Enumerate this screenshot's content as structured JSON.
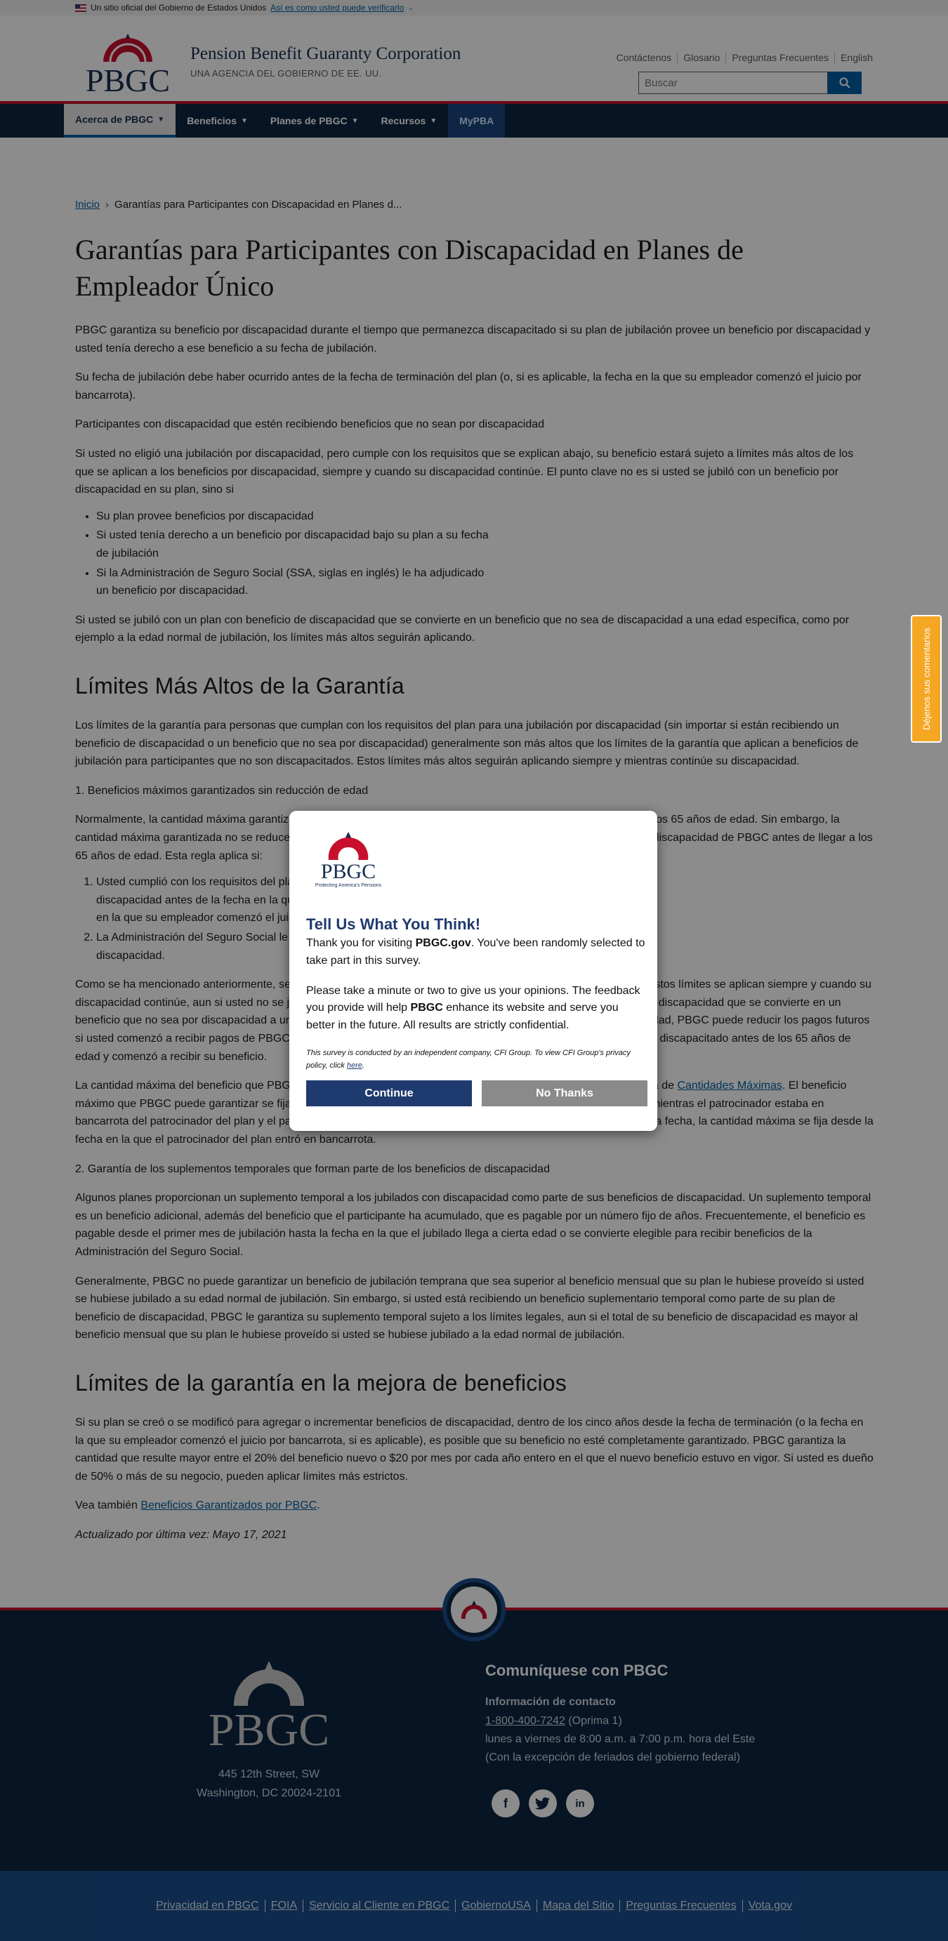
{
  "gov_banner": {
    "text": "Un sitio oficial del Gobierno de Estados Unidos",
    "link": "Así es como usted puede verificarlo"
  },
  "header": {
    "agency_name": "Pension Benefit Guaranty Corporation",
    "agency_sub": "UNA AGENCIA DEL GOBIERNO DE EE. UU.",
    "logo_text": "PBGC",
    "utility_links": [
      "Contáctenos",
      "Glosario",
      "Preguntas Frecuentes",
      "English"
    ],
    "search_placeholder": "Buscar"
  },
  "nav": {
    "items": [
      "Acerca de PBGC",
      "Beneficios",
      "Planes de PBGC",
      "Recursos",
      "MyPBA"
    ]
  },
  "breadcrumb": {
    "home": "Inicio",
    "current": "Garantías para Participantes con Discapacidad en Planes d..."
  },
  "page": {
    "title": "Garantías para Participantes con Discapacidad en Planes de Empleador Único",
    "p1": "PBGC garantiza su beneficio por discapacidad durante el tiempo que permanezca discapacitado si su plan de jubilación provee un beneficio por discapacidad y usted tenía derecho a ese beneficio a su fecha de jubilación.",
    "p2": "Su fecha de jubilación debe haber ocurrido antes de la fecha de terminación del plan (o, si es aplicable, la fecha en la que su empleador comenzó el juicio por bancarrota).",
    "p3": "Participantes con discapacidad que estén recibiendo beneficios que no sean por discapacidad",
    "p4": "Si usted no eligió una jubilación por discapacidad, pero cumple con los requisitos que se explican abajo, su beneficio estará sujeto a límites más altos de los que se aplican a los beneficios por discapacidad, siempre y cuando su discapacidad continúe. El punto clave no es si usted se jubiló con un beneficio por discapacidad en su plan, sino si",
    "list1": [
      "Su plan provee beneficios por discapacidad",
      "Si usted tenía derecho a un beneficio por discapacidad bajo su plan a su fecha de jubilación",
      "Si la Administración de Seguro Social (SSA, siglas en inglés) le ha adjudicado un beneficio por discapacidad."
    ],
    "p5": "Si usted se jubiló con un plan con beneficio de discapacidad que se convierte en un beneficio que no sea de discapacidad a una edad específica, como por ejemplo a la edad normal de jubilación, los límites más altos seguirán aplicando.",
    "h2_1": "Límites Más Altos de la Garantía",
    "p6": "Los límites de la garantía para personas que cumplan con los requisitos del plan para una jubilación por discapacidad (sin importar si están recibiendo un beneficio de discapacidad o un beneficio que no sea por discapacidad) generalmente son más altos que los límites de la garantía que aplican a beneficios de jubilación para participantes que no son discapacitados. Estos límites más altos seguirán aplicando siempre y mientras continúe su discapacidad.",
    "p7": "1. Beneficios máximos garantizados sin reducción de edad",
    "p8": "Normalmente, la cantidad máxima garantizada por PBGC se reduce si usted comienza a recibir beneficios antes de los 65 años de edad. Sin embargo, la cantidad máxima garantizada no se reduce por edad si usted recibe beneficios de PBGC y cumple los requisitos de discapacidad de PBGC antes de llegar a los 65 años de edad. Esta regla aplica si:",
    "list2": [
      "Usted cumplió con los requisitos del plan para recibir un beneficio de discapacidad antes de la fecha en la que terminó su plan (o, si aplica, la fecha en la que su empleador comenzó el juicio por bancarrota), y",
      "La Administración del Seguro Social le ha adjudicado beneficios por discapacidad."
    ],
    "p9": "Como se ha mencionado anteriormente, se aplican límites más altos que los aplicables a beneficios por jubilación. Estos límites se aplican siempre y cuando su discapacidad continúe, aun si usted no se jubiló con un beneficio por discapacidad o si se jubiló con un beneficio por discapacidad que se convierte en un beneficio que no sea por discapacidad a una edad específica. Si su discapacidad termina antes de los 65 años de edad, PBGC puede reducir los pagos futuros si usted comenzó a recibir pagos de PBGC después de los 65 años de edad. El máximo se reduce si se le considera discapacitado antes de los 65 años de edad y comenzó a recibir su beneficio.",
    "p10a": "La cantidad máxima del beneficio que PBGC puede garantizar depende de cuándo terminó su plan. Consulte la tabla de ",
    "p10link": "Cantidades Máximas",
    "p10b": ". El beneficio máximo que PBGC puede garantizar se fija desde la fecha de terminación del plan. Sin embargo, si el plan terminó mientras el patrocinador estaba en bancarrota del patrocinador del plan y el patrocinador entró en bancarrota el 16 de octubre de 2008 o después de esa fecha, la cantidad máxima se fija desde la fecha en la que el patrocinador del plan entró en bancarrota.",
    "p11": "2. Garantía de los suplementos temporales que forman parte de los beneficios de discapacidad",
    "p12": "Algunos planes proporcionan un suplemento temporal a los jubilados con discapacidad como parte de sus beneficios de discapacidad. Un suplemento temporal es un beneficio adicional, además del beneficio que el participante ha acumulado, que es pagable por un número fijo de años. Frecuentemente, el beneficio es pagable desde el primer mes de jubilación hasta la fecha en la que el jubilado llega a cierta edad o se convierte elegible para recibir beneficios de la Administración del Seguro Social.",
    "p13": "Generalmente, PBGC no puede garantizar un beneficio de jubilación temprana que sea superior al beneficio mensual que su plan le hubiese proveído si usted se hubiese jubilado a su edad normal de jubilación. Sin embargo, si usted está recibiendo un beneficio suplementario temporal como parte de su plan de beneficio de discapacidad, PBGC le garantiza su suplemento temporal sujeto a los límites legales, aun si el total de su beneficio de discapacidad es mayor al beneficio mensual que su plan le hubiese proveído si usted se hubiese jubilado a la edad normal de jubilación.",
    "h2_2": "Límites de la garantía en la mejora de beneficios",
    "p14": "Si su plan se creó o se modificó para agregar o incrementar beneficios de discapacidad, dentro de los cinco años desde la fecha de terminación (o la fecha en la que su empleador comenzó el juicio por bancarrota, si es aplicable), es posible que su beneficio no esté completamente garantizado. PBGC garantiza la cantidad que resulte mayor entre el 20% del beneficio nuevo o $20 por mes por cada año entero en el que el nuevo beneficio estuvo en vigor. Si usted es dueño de 50% o más de su negocio, pueden aplicar límites más estrictos.",
    "see_also_prefix": "Vea también ",
    "see_also_link": "Beneficios Garantizados por PBGC",
    "see_also_suffix": ".",
    "updated": "Actualizado por última vez: Mayo 17, 2021"
  },
  "feedback_tab": "Déjenos sus comentarios",
  "survey": {
    "logo_text": "PBGC",
    "logo_tagline": "Protecting America's Pensions",
    "title": "Tell Us What You Think!",
    "intro_prefix": "Thank you for visiting ",
    "intro_bold": "PBGC.gov",
    "intro_suffix": ". You've been randomly selected to take part in this survey.",
    "body_prefix": "Please take a minute or two to give us your opinions. The feedback you provide will help ",
    "body_bold": "PBGC",
    "body_suffix": " enhance its website and serve you better in the future. All results are strictly confidential.",
    "fine_print": "This survey is conducted by an independent company, CFI Group. To view CFI Group's privacy policy, click ",
    "fine_link": "here",
    "fine_end": ".",
    "continue": "Continue",
    "no_thanks": "No Thanks"
  },
  "footer": {
    "logo_text": "PBGC",
    "address_line1": "445 12th Street, SW",
    "address_line2": "Washington, DC 20024-2101",
    "contact_title": "Comuníquese con PBGC",
    "contact_label": "Información de contacto",
    "phone": "1-800-400-7242",
    "phone_suffix": " (Oprima 1)",
    "hours": "lunes a viernes de 8:00 a.m. a 7:00 p.m. hora del Este",
    "holidays": "(Con la excepción de feriados del gobierno federal)",
    "bottom_links": [
      "Privacidad en PBGC",
      "FOIA",
      "Servicio al Cliente en PBGC",
      "GobiernoUSA",
      "Mapa del Sitio",
      "Preguntas Frecuentes",
      "Vota.gov"
    ]
  },
  "colors": {
    "navy": "#0b2540",
    "accent_red": "#c8102e",
    "link_blue": "#005ea2",
    "survey_blue": "#1f3a6e",
    "feedback_orange": "#f5a623"
  }
}
